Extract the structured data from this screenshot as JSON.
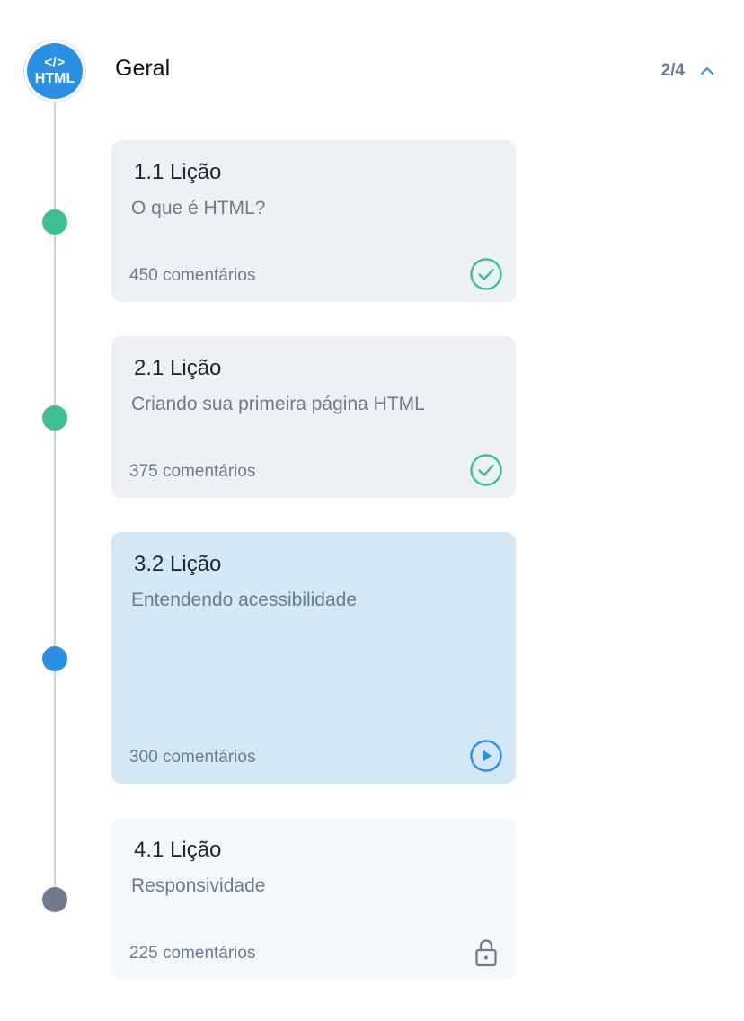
{
  "course": {
    "badge_code": "</>",
    "badge_label": "HTML"
  },
  "section": {
    "title": "Geral",
    "progress": "2/4"
  },
  "lessons": [
    {
      "title": "1.1 Lição",
      "subtitle": "O que é HTML?",
      "comments": "450 comentários",
      "status": "completed",
      "icon": "check-circle-icon"
    },
    {
      "title": "2.1 Lição",
      "subtitle": "Criando sua primeira página HTML",
      "comments": "375 comentários",
      "status": "completed",
      "icon": "check-circle-icon"
    },
    {
      "title": "3.2 Lição",
      "subtitle": "Entendendo acessibilidade",
      "comments": "300 comentários",
      "status": "in-progress",
      "icon": "play-circle-icon"
    },
    {
      "title": "4.1 Lição",
      "subtitle": "Responsividade",
      "comments": "225 comentários",
      "status": "locked",
      "icon": "lock-icon"
    }
  ],
  "colors": {
    "completed": "#3dbf91",
    "in_progress": "#2b8fe3",
    "locked": "#6f7a8d",
    "card_default": "#edf1f5",
    "card_active": "#d4e7f7",
    "card_locked": "#f5f8fb"
  }
}
